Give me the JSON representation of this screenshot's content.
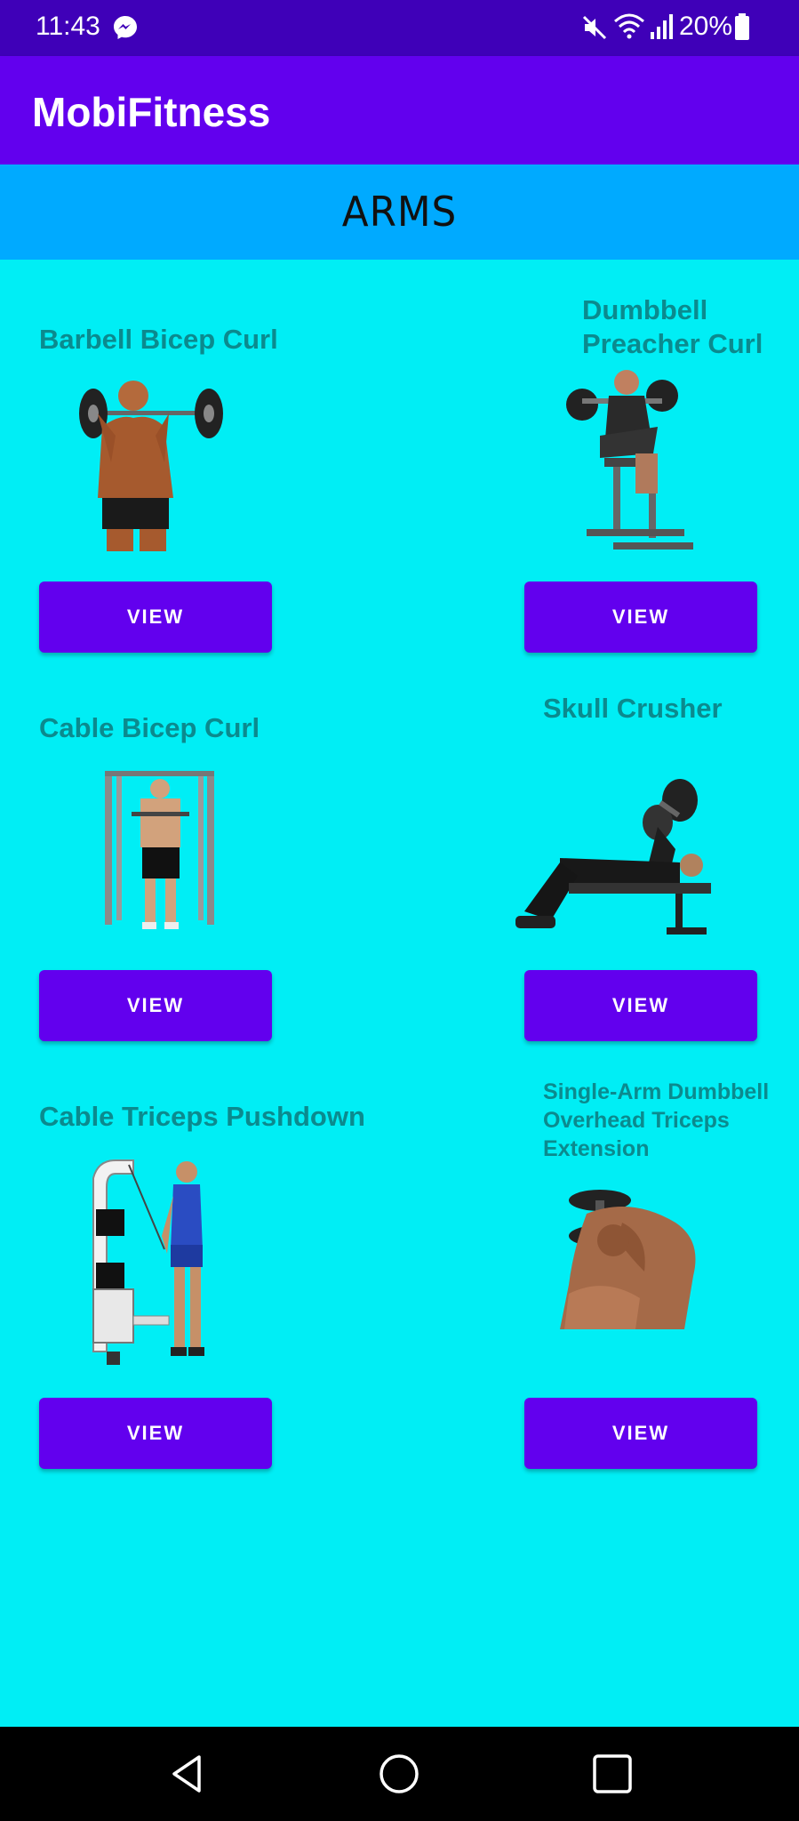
{
  "status_bar": {
    "time": "11:43",
    "battery": "20%",
    "icons": [
      "messenger-icon",
      "mute-icon",
      "wifi-icon",
      "signal-icon",
      "battery-icon"
    ]
  },
  "app_bar": {
    "title": "MobiFitness"
  },
  "category": {
    "title": "ARMS"
  },
  "exercises": [
    {
      "name": "Barbell Bicep Curl",
      "button": "VIEW",
      "image": "barbell-bicep-curl-image"
    },
    {
      "name": "Dumbbell Preacher Curl",
      "button": "VIEW",
      "image": "dumbbell-preacher-curl-image"
    },
    {
      "name": "Cable Bicep Curl",
      "button": "VIEW",
      "image": "cable-bicep-curl-image"
    },
    {
      "name": "Skull Crusher",
      "button": "VIEW",
      "image": "skull-crusher-image"
    },
    {
      "name": "Cable Triceps Pushdown",
      "button": "VIEW",
      "image": "cable-triceps-pushdown-image"
    },
    {
      "name": "Single-Arm Dumbbell Overhead Triceps Extension",
      "button": "VIEW",
      "image": "overhead-triceps-extension-image"
    }
  ],
  "nav_bar": {
    "icons": [
      "back-icon",
      "home-icon",
      "recents-icon"
    ]
  },
  "colors": {
    "status_bar": "#3F00B8",
    "app_bar": "#6200EE",
    "category_bar": "#00AAFF",
    "background": "#00EEF5",
    "exercise_title": "#0B8A8E",
    "button": "#6200EE"
  }
}
